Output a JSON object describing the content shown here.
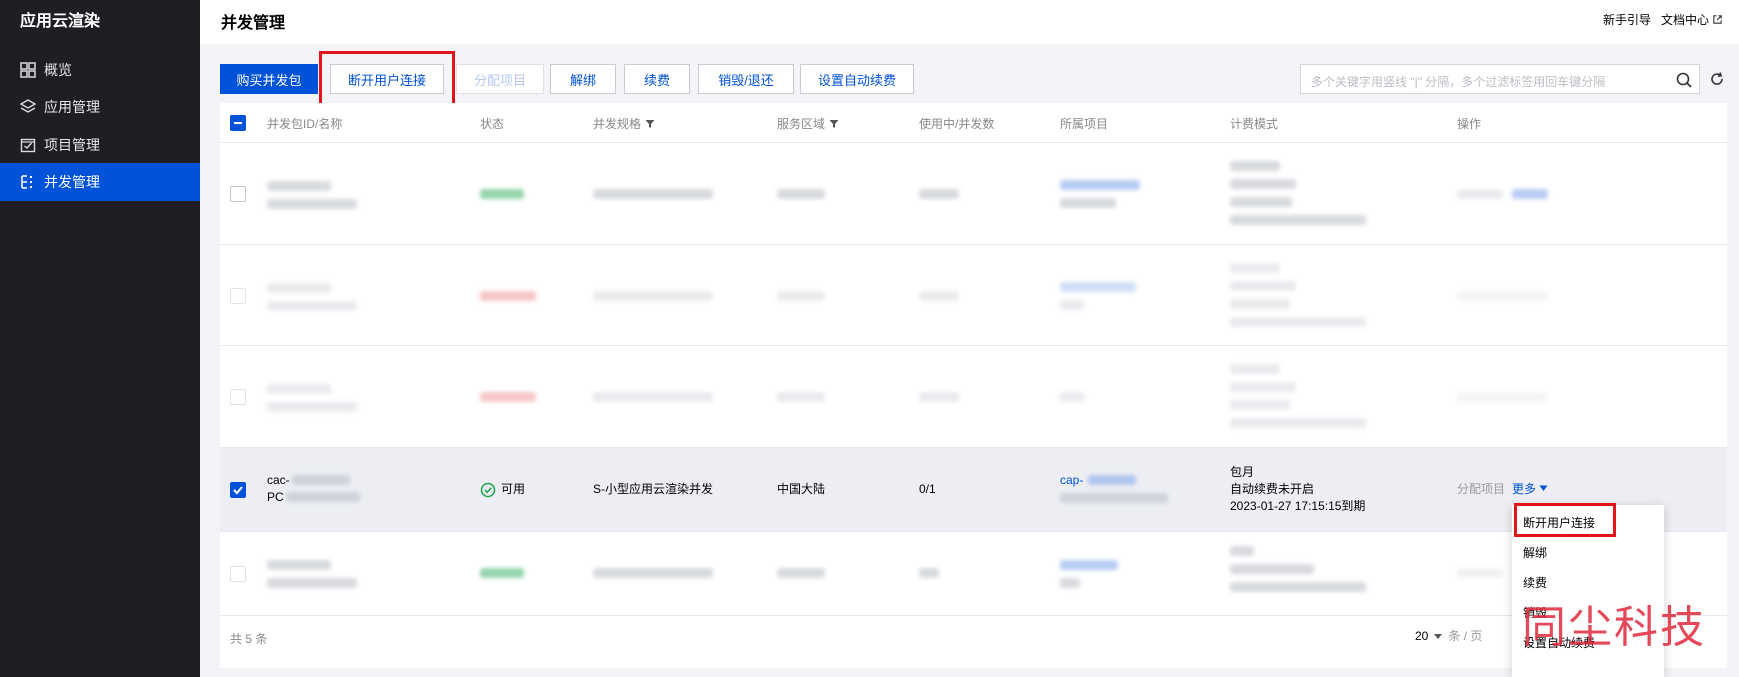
{
  "sidebar": {
    "brand": "应用云渲染",
    "items": [
      {
        "label": "概览",
        "icon": "grid-icon",
        "active": false
      },
      {
        "label": "应用管理",
        "icon": "layers-icon",
        "active": false
      },
      {
        "label": "项目管理",
        "icon": "project-icon",
        "active": false
      },
      {
        "label": "并发管理",
        "icon": "list-icon",
        "active": true
      }
    ]
  },
  "header": {
    "title": "并发管理",
    "links": [
      "新手引导",
      "文档中心"
    ]
  },
  "toolbar": {
    "buy": "购买并发包",
    "disconnect": "断开用户连接",
    "assign": "分配项目",
    "unbind": "解绑",
    "renew": "续费",
    "destroy": "销毁/退还",
    "auto_renew": "设置自动续费",
    "search_placeholder": "多个关键字用竖线 \"|\" 分隔，多个过滤标签用回车键分隔"
  },
  "table": {
    "columns": [
      "并发包ID/名称",
      "状态",
      "并发规格",
      "服务区域",
      "使用中/并发数",
      "所属项目",
      "计费模式",
      "操作"
    ],
    "selected_row": {
      "id": "cac-",
      "name": "PC",
      "status": "可用",
      "spec": "S-小型应用云渲染并发",
      "region": "中国大陆",
      "usage": "0/1",
      "project": "cap-",
      "billing": [
        "包月",
        "自动续费未开启",
        "2023-01-27 17:15:15到期"
      ],
      "action_assign": "分配项目",
      "action_more": "更多"
    },
    "total": "共 5 条",
    "page_size": "20",
    "page_unit": "条 / 页"
  },
  "more_menu": [
    "断开用户连接",
    "解绑",
    "续费",
    "销毁",
    "设置自动续费"
  ],
  "watermark": "同尘科技",
  "colors": {
    "accent": "#0052d9",
    "sidebar": "#1d1f24",
    "highlight": "#e0161a",
    "ok": "#1aa34a"
  }
}
